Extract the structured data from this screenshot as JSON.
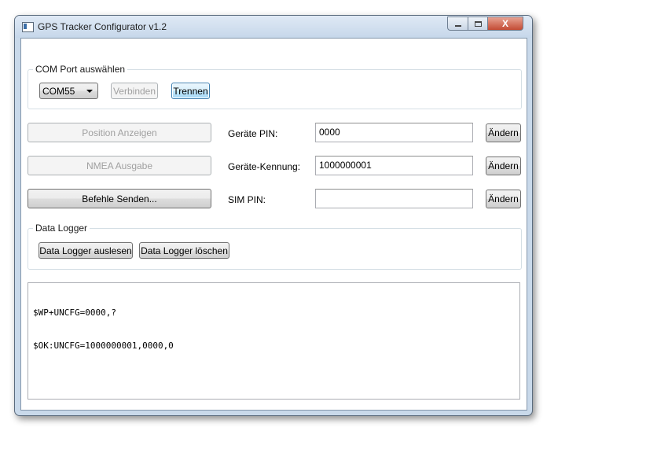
{
  "window": {
    "title": "GPS Tracker Configurator v1.2",
    "controls": {
      "minimize": "minimize",
      "maximize": "maximize",
      "close": "X"
    }
  },
  "com_port": {
    "legend": "COM Port auswählen",
    "selected_port": "COM55",
    "connect_label": "Verbinden",
    "disconnect_label": "Trennen"
  },
  "actions": {
    "position_label": "Position Anzeigen",
    "nmea_label": "NMEA Ausgabe",
    "commands_label": "Befehle Senden..."
  },
  "settings": {
    "device_pin": {
      "label": "Geräte PIN:",
      "value": "0000",
      "change_label": "Ändern"
    },
    "device_id": {
      "label": "Geräte-Kennung:",
      "value": "1000000001",
      "change_label": "Ändern"
    },
    "sim_pin": {
      "label": "SIM PIN:",
      "value": "",
      "change_label": "Ändern"
    }
  },
  "data_logger": {
    "legend": "Data Logger",
    "read_label": "Data Logger auslesen",
    "delete_label": "Data Logger löschen"
  },
  "log": {
    "lines": [
      "$WP+UNCFG=0000,?",
      "$OK:UNCFG=1000000001,0000,0"
    ]
  }
}
